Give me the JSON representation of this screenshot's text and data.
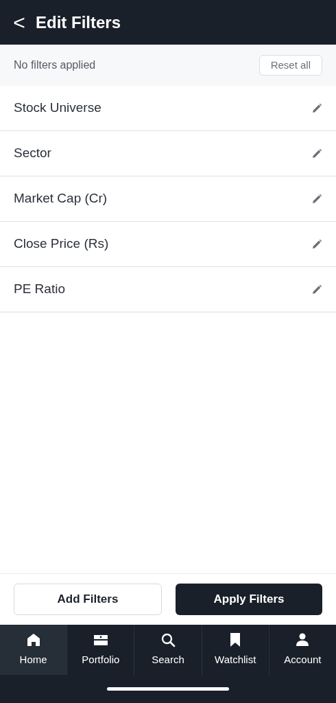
{
  "header": {
    "back": "<",
    "title": "Edit Filters"
  },
  "status_bar": {
    "text": "No filters applied",
    "reset_button": "Reset all"
  },
  "filters": [
    {
      "label": "Stock Universe"
    },
    {
      "label": "Sector"
    },
    {
      "label": "Market Cap (Cr)"
    },
    {
      "label": "Close Price (Rs)"
    },
    {
      "label": "PE Ratio"
    }
  ],
  "actions": {
    "add": "Add Filters",
    "apply": "Apply Filters"
  },
  "tab_bar": [
    {
      "kind": "home",
      "label": "Home",
      "selected": true
    },
    {
      "kind": "portfolio",
      "label": "Portfolio",
      "selected": false
    },
    {
      "kind": "search",
      "label": "Search",
      "selected": false
    },
    {
      "kind": "watchlist",
      "label": "Watchlist",
      "selected": false
    },
    {
      "kind": "account",
      "label": "Account",
      "selected": false
    }
  ]
}
